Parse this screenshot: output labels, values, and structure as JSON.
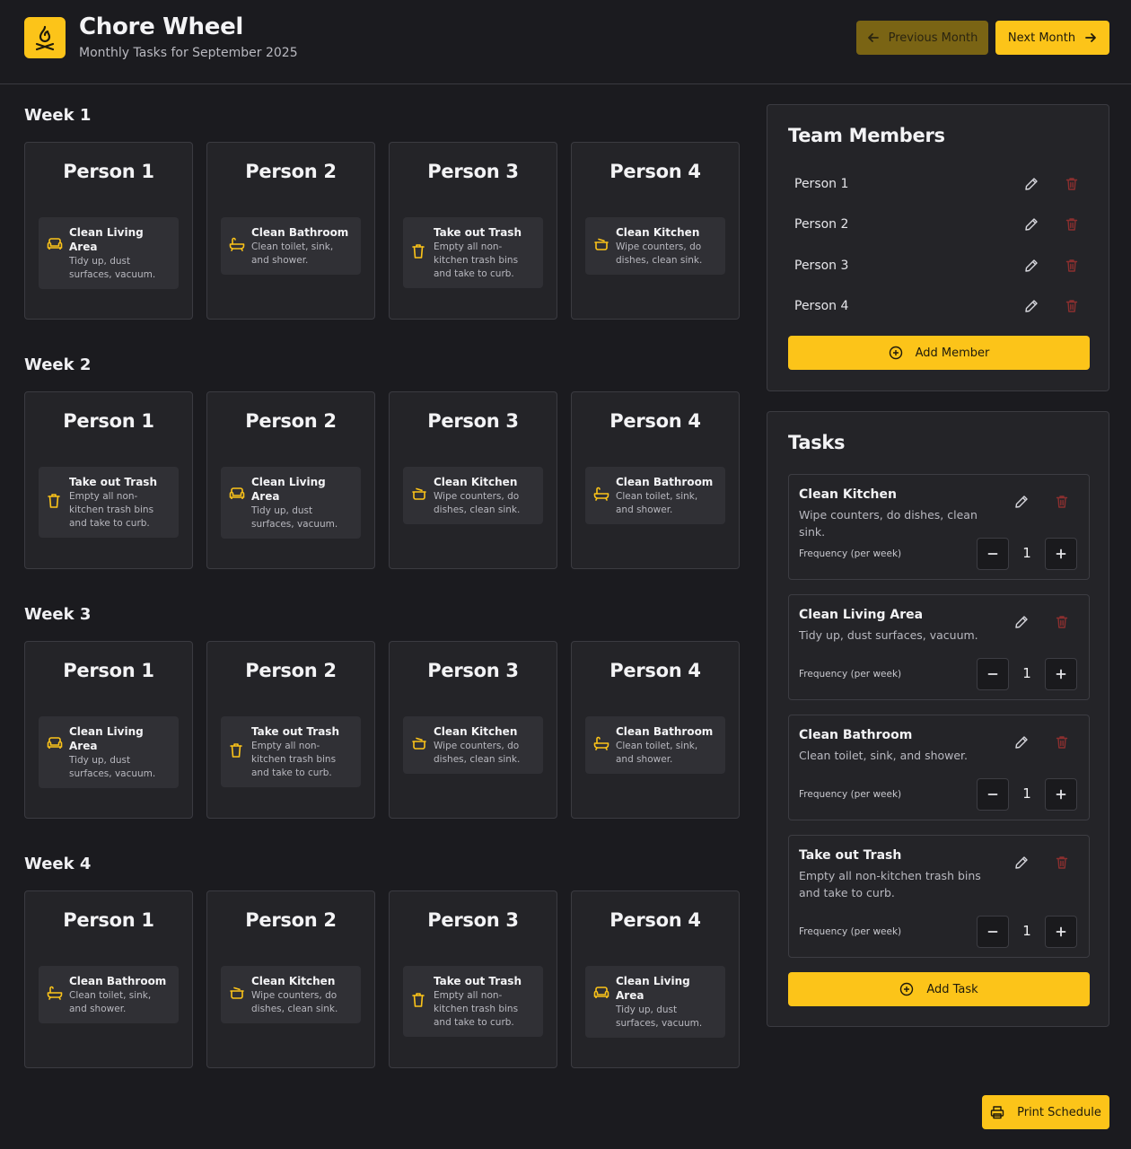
{
  "header": {
    "title": "Chore Wheel",
    "subtitle": "Monthly Tasks for September 2025",
    "prev_label": "Previous Month",
    "next_label": "Next Month",
    "accent": "#fcc419"
  },
  "weeks": [
    {
      "label": "Week 1",
      "people": [
        {
          "name": "Person 1",
          "task": "Clean Living Area",
          "desc": "Tidy up, dust surfaces, vacuum.",
          "icon": "sofa-icon"
        },
        {
          "name": "Person 2",
          "task": "Clean Bathroom",
          "desc": "Clean toilet, sink, and shower.",
          "icon": "bathtub-icon"
        },
        {
          "name": "Person 3",
          "task": "Take out Trash",
          "desc": "Empty all non-kitchen trash bins and take to curb.",
          "icon": "trash-icon"
        },
        {
          "name": "Person 4",
          "task": "Clean Kitchen",
          "desc": "Wipe counters, do dishes, clean sink.",
          "icon": "cooking-pot-icon"
        }
      ]
    },
    {
      "label": "Week 2",
      "people": [
        {
          "name": "Person 1",
          "task": "Take out Trash",
          "desc": "Empty all non-kitchen trash bins and take to curb.",
          "icon": "trash-icon"
        },
        {
          "name": "Person 2",
          "task": "Clean Living Area",
          "desc": "Tidy up, dust surfaces, vacuum.",
          "icon": "sofa-icon"
        },
        {
          "name": "Person 3",
          "task": "Clean Kitchen",
          "desc": "Wipe counters, do dishes, clean sink.",
          "icon": "cooking-pot-icon"
        },
        {
          "name": "Person 4",
          "task": "Clean Bathroom",
          "desc": "Clean toilet, sink, and shower.",
          "icon": "bathtub-icon"
        }
      ]
    },
    {
      "label": "Week 3",
      "people": [
        {
          "name": "Person 1",
          "task": "Clean Living Area",
          "desc": "Tidy up, dust surfaces, vacuum.",
          "icon": "sofa-icon"
        },
        {
          "name": "Person 2",
          "task": "Take out Trash",
          "desc": "Empty all non-kitchen trash bins and take to curb.",
          "icon": "trash-icon"
        },
        {
          "name": "Person 3",
          "task": "Clean Kitchen",
          "desc": "Wipe counters, do dishes, clean sink.",
          "icon": "cooking-pot-icon"
        },
        {
          "name": "Person 4",
          "task": "Clean Bathroom",
          "desc": "Clean toilet, sink, and shower.",
          "icon": "bathtub-icon"
        }
      ]
    },
    {
      "label": "Week 4",
      "people": [
        {
          "name": "Person 1",
          "task": "Clean Bathroom",
          "desc": "Clean toilet, sink, and shower.",
          "icon": "bathtub-icon"
        },
        {
          "name": "Person 2",
          "task": "Clean Kitchen",
          "desc": "Wipe counters, do dishes, clean sink.",
          "icon": "cooking-pot-icon"
        },
        {
          "name": "Person 3",
          "task": "Take out Trash",
          "desc": "Empty all non-kitchen trash bins and take to curb.",
          "icon": "trash-icon"
        },
        {
          "name": "Person 4",
          "task": "Clean Living Area",
          "desc": "Tidy up, dust surfaces, vacuum.",
          "icon": "sofa-icon"
        }
      ]
    }
  ],
  "members": {
    "title": "Team Members",
    "list": [
      "Person 1",
      "Person 2",
      "Person 3",
      "Person 4"
    ],
    "add_label": "Add Member"
  },
  "tasks": {
    "title": "Tasks",
    "frequency_label": "Frequency (per week)",
    "list": [
      {
        "name": "Clean Kitchen",
        "desc": "Wipe counters, do dishes, clean sink.",
        "frequency": "1"
      },
      {
        "name": "Clean Living Area",
        "desc": "Tidy up, dust surfaces, vacuum.",
        "frequency": "1"
      },
      {
        "name": "Clean Bathroom",
        "desc": "Clean toilet, sink, and shower.",
        "frequency": "1"
      },
      {
        "name": "Take out Trash",
        "desc": "Empty all non-kitchen trash bins and take to curb.",
        "frequency": "1"
      }
    ],
    "add_label": "Add Task"
  },
  "print_label": "Print Schedule",
  "colors": {
    "danger": "#8b2f2f",
    "muted_text": "#b9b9c0"
  }
}
